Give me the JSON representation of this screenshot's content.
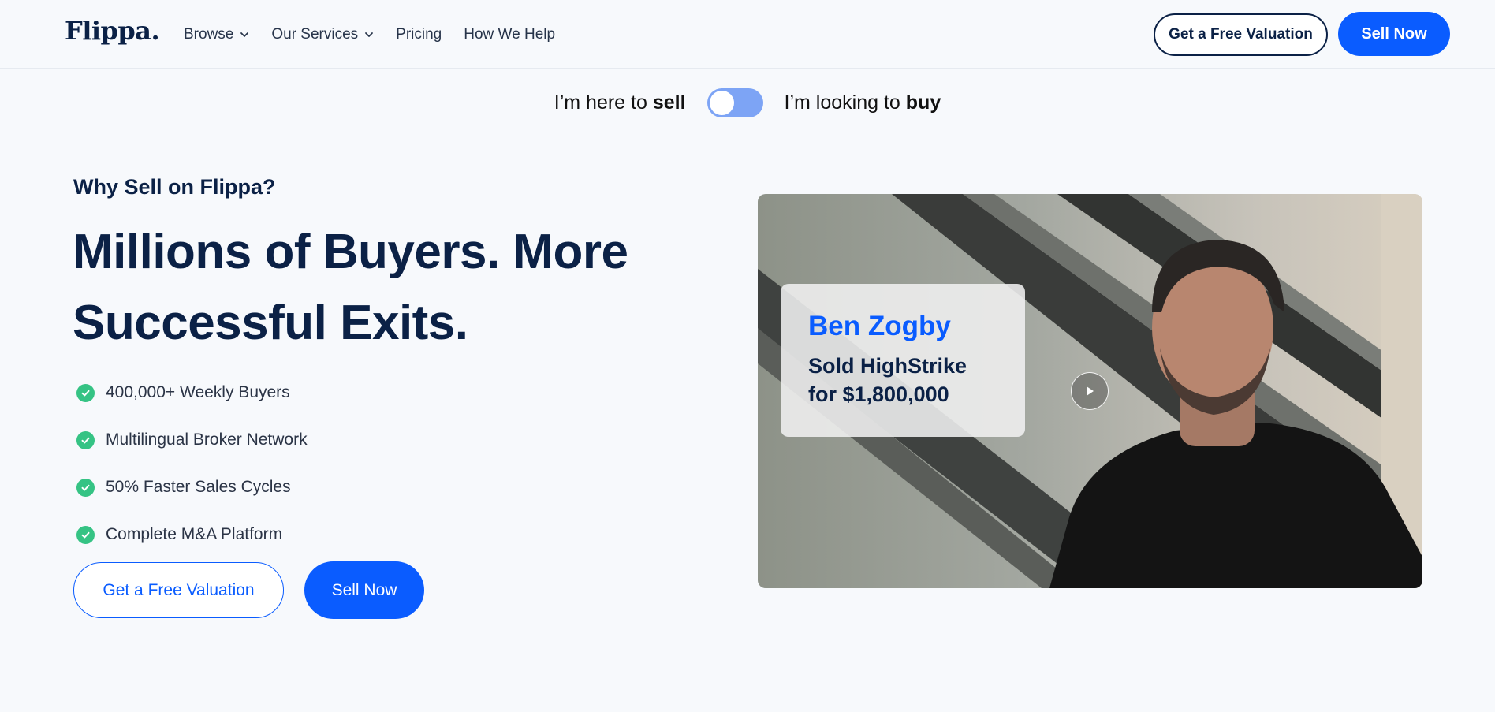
{
  "header": {
    "logo": "Flippa.",
    "nav": [
      {
        "label": "Browse",
        "has_dropdown": true
      },
      {
        "label": "Our Services",
        "has_dropdown": true
      },
      {
        "label": "Pricing",
        "has_dropdown": false
      },
      {
        "label": "How We Help",
        "has_dropdown": false
      }
    ],
    "valuation_button": "Get a Free Valuation",
    "sell_button": "Sell Now"
  },
  "toggle": {
    "sell_prefix": "I’m here to",
    "sell_word": "sell",
    "buy_prefix": "I’m looking to",
    "buy_word": "buy",
    "state": "sell"
  },
  "hero": {
    "eyebrow": "Why Sell on Flippa?",
    "headline": "Millions of Buyers. More Successful Exits.",
    "features": [
      "400,000+ Weekly Buyers",
      "Multilingual Broker Network",
      "50% Faster Sales Cycles",
      "Complete M&A Platform"
    ],
    "cta_valuation": "Get a Free Valuation",
    "cta_sell": "Sell Now"
  },
  "video": {
    "name": "Ben Zogby",
    "detail": "Sold HighStrike for $1,800,000",
    "play_icon": "play-icon"
  },
  "colors": {
    "brand_blue": "#0a5cff",
    "navy": "#0b2146",
    "check_green": "#35c384",
    "toggle_blue": "#7da4f5",
    "background": "#f7f9fc"
  }
}
